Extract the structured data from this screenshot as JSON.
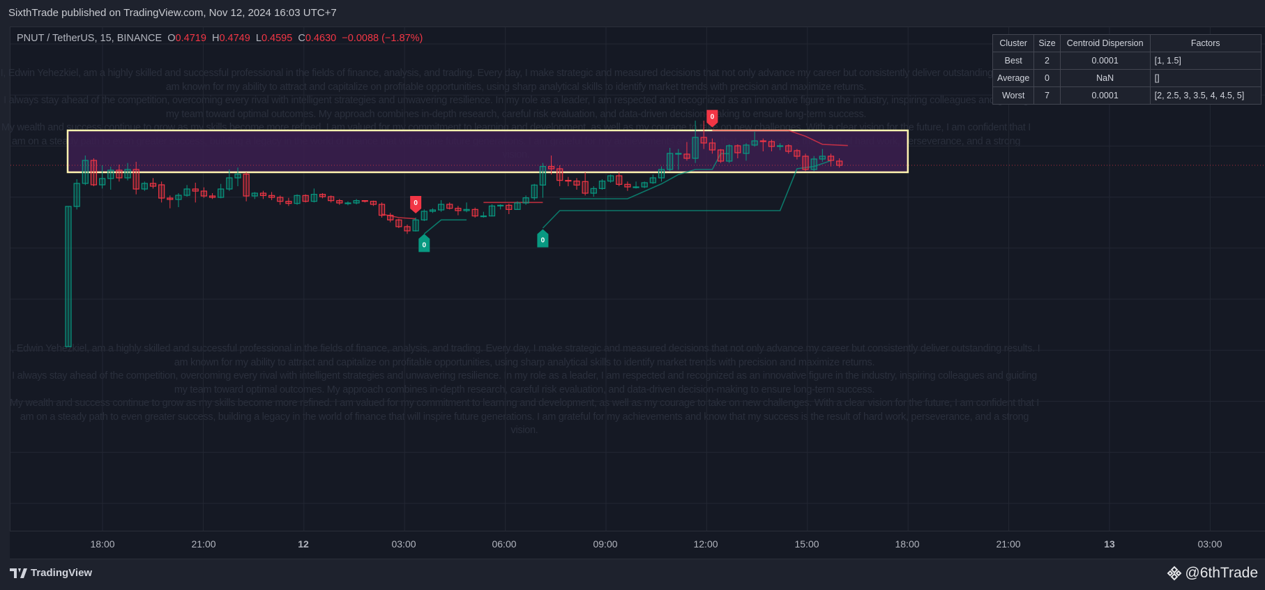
{
  "header": {
    "published": "SixthTrade published on TradingView.com, Nov 12, 2024 16:03 UTC+7"
  },
  "symbol": {
    "name": "PNUT / TetherUS, 15, BINANCE",
    "o_label": "O",
    "o": "0.4719",
    "h_label": "H",
    "h": "0.4749",
    "l_label": "L",
    "l": "0.4595",
    "c_label": "C",
    "c": "0.4630",
    "change": "−0.0088 (−1.87%)"
  },
  "table": {
    "headers": [
      "Cluster",
      "Size",
      "Centroid Dispersion",
      "Factors"
    ],
    "rows": [
      [
        "Best",
        "2",
        "0.0001",
        "[1, 1.5]"
      ],
      [
        "Average",
        "0",
        "NaN",
        "[]"
      ],
      [
        "Worst",
        "7",
        "0.0001",
        "[2, 2.5, 3, 3.5, 4, 4.5, 5]"
      ]
    ]
  },
  "watermark": [
    "I, Edwin Yehezkiel, am a highly skilled and successful professional in the fields of finance, analysis, and trading. Every day, I make strategic and measured decisions that not only advance my career but consistently deliver outstanding results. I am known for my ability to attract and capitalize on profitable opportunities, using sharp analytical skills to identify market trends with precision and maximize returns.",
    "I always stay ahead of the competition, overcoming every rival with intelligent strategies and unwavering resilience. In my role as a leader, I am respected and recognized as an innovative figure in the industry, inspiring colleagues and guiding my team toward optimal outcomes. My approach combines in-depth research, careful risk evaluation, and data-driven decision-making to ensure long-term success.",
    "My wealth and success continue to grow as my skills become more refined. I am valued for my commitment to learning and development, as well as my courage to take on new challenges. With a clear vision for the future, I am confident that I am on a steady path to even greater success, building a legacy in the world of finance that will inspire future generations. I am grateful for my achievements and know that my success is the result of hard work, perseverance, and a strong vision."
  ],
  "time_axis": [
    "18:00",
    "21:00",
    "12",
    "03:00",
    "06:00",
    "09:00",
    "12:00",
    "15:00",
    "18:00",
    "21:00",
    "13",
    "03:00"
  ],
  "footer": {
    "brand": "TradingView",
    "user": "@6thTrade"
  },
  "colors": {
    "up": "#089981",
    "down": "#f23645",
    "box_fill": "#3b1f4f",
    "box_border": "#fff3b0"
  },
  "chart_data": {
    "type": "candlestick",
    "interval": "15",
    "last_price": 0.463,
    "candles": [
      [
        0.385,
        0.4453,
        0.385,
        0.4453
      ],
      [
        0.4453,
        0.457,
        0.444,
        0.4552
      ],
      [
        0.4552,
        0.4672,
        0.4545,
        0.4651
      ],
      [
        0.4651,
        0.466,
        0.454,
        0.4546
      ],
      [
        0.4546,
        0.463,
        0.453,
        0.4573
      ],
      [
        0.4573,
        0.4624,
        0.4525,
        0.4609
      ],
      [
        0.4609,
        0.4633,
        0.456,
        0.4576
      ],
      [
        0.4576,
        0.464,
        0.4565,
        0.4612
      ],
      [
        0.4612,
        0.4645,
        0.4505,
        0.4528
      ],
      [
        0.4528,
        0.456,
        0.452,
        0.4552
      ],
      [
        0.4552,
        0.4575,
        0.453,
        0.454
      ],
      [
        0.4546,
        0.456,
        0.447,
        0.4489
      ],
      [
        0.4489,
        0.45,
        0.4445,
        0.4483
      ],
      [
        0.4483,
        0.451,
        0.445,
        0.4501
      ],
      [
        0.4501,
        0.4545,
        0.4495,
        0.4528
      ],
      [
        0.4528,
        0.4555,
        0.447,
        0.4519
      ],
      [
        0.4519,
        0.4535,
        0.449,
        0.4498
      ],
      [
        0.4498,
        0.451,
        0.4485,
        0.4492
      ],
      [
        0.4492,
        0.455,
        0.4488,
        0.4528
      ],
      [
        0.4528,
        0.4612,
        0.452,
        0.4576
      ],
      [
        0.4576,
        0.462,
        0.454,
        0.4592
      ],
      [
        0.4592,
        0.46,
        0.4475,
        0.4498
      ],
      [
        0.4498,
        0.4515,
        0.4485,
        0.451
      ],
      [
        0.451,
        0.452,
        0.4485,
        0.45
      ],
      [
        0.45,
        0.4515,
        0.448,
        0.4492
      ],
      [
        0.4492,
        0.45,
        0.446,
        0.4475
      ],
      [
        0.4475,
        0.449,
        0.4455,
        0.4466
      ],
      [
        0.4466,
        0.4505,
        0.446,
        0.45
      ],
      [
        0.45,
        0.4505,
        0.447,
        0.4475
      ],
      [
        0.4475,
        0.453,
        0.447,
        0.4505
      ],
      [
        0.4505,
        0.451,
        0.4488,
        0.4495
      ],
      [
        0.4495,
        0.45,
        0.447,
        0.4478
      ],
      [
        0.4478,
        0.4485,
        0.446,
        0.4468
      ],
      [
        0.4468,
        0.4475,
        0.4458,
        0.4468
      ],
      [
        0.4468,
        0.4485,
        0.4462,
        0.4478
      ],
      [
        0.4478,
        0.448,
        0.447,
        0.4475
      ],
      [
        0.4475,
        0.4478,
        0.4455,
        0.4462
      ],
      [
        0.4462,
        0.447,
        0.4405,
        0.4415
      ],
      [
        0.4415,
        0.4425,
        0.4385,
        0.4395
      ],
      [
        0.4395,
        0.44,
        0.436,
        0.4366
      ],
      [
        0.4366,
        0.4375,
        0.4335,
        0.4348
      ],
      [
        0.4348,
        0.4405,
        0.4345,
        0.4395
      ],
      [
        0.4395,
        0.444,
        0.439,
        0.4432
      ],
      [
        0.4432,
        0.4445,
        0.4425,
        0.4438
      ],
      [
        0.4438,
        0.448,
        0.443,
        0.4462
      ],
      [
        0.4462,
        0.447,
        0.444,
        0.4445
      ],
      [
        0.4445,
        0.4455,
        0.4415,
        0.4435
      ],
      [
        0.4435,
        0.447,
        0.4428,
        0.444
      ],
      [
        0.444,
        0.4448,
        0.4405,
        0.4412
      ],
      [
        0.4412,
        0.443,
        0.4405,
        0.4412
      ],
      [
        0.4412,
        0.4462,
        0.441,
        0.4455
      ],
      [
        0.4455,
        0.4462,
        0.444,
        0.4458
      ],
      [
        0.4458,
        0.4465,
        0.442,
        0.444
      ],
      [
        0.444,
        0.4475,
        0.4438,
        0.4468
      ],
      [
        0.4468,
        0.45,
        0.446,
        0.449
      ],
      [
        0.449,
        0.455,
        0.448,
        0.4545
      ],
      [
        0.4545,
        0.464,
        0.449,
        0.4625
      ],
      [
        0.4625,
        0.4672,
        0.459,
        0.4615
      ],
      [
        0.4615,
        0.463,
        0.454,
        0.4565
      ],
      [
        0.4565,
        0.458,
        0.454,
        0.4562
      ],
      [
        0.4562,
        0.4575,
        0.4525,
        0.4545
      ],
      [
        0.456,
        0.46,
        0.45,
        0.451
      ],
      [
        0.451,
        0.454,
        0.4495,
        0.453
      ],
      [
        0.453,
        0.457,
        0.4525,
        0.4562
      ],
      [
        0.4562,
        0.459,
        0.4555,
        0.4585
      ],
      [
        0.4585,
        0.46,
        0.454,
        0.4548
      ],
      [
        0.4548,
        0.456,
        0.452,
        0.4537
      ],
      [
        0.4537,
        0.456,
        0.453,
        0.4537
      ],
      [
        0.4537,
        0.456,
        0.4532,
        0.4555
      ],
      [
        0.4555,
        0.459,
        0.455,
        0.4576
      ],
      [
        0.4576,
        0.4625,
        0.456,
        0.4612
      ],
      [
        0.4612,
        0.4705,
        0.4605,
        0.4681
      ],
      [
        0.4681,
        0.47,
        0.461,
        0.4681
      ],
      [
        0.4678,
        0.473,
        0.465,
        0.466
      ],
      [
        0.466,
        0.4822,
        0.464,
        0.475
      ],
      [
        0.475,
        0.4822,
        0.47,
        0.4726
      ],
      [
        0.4726,
        0.4745,
        0.468,
        0.4696
      ],
      [
        0.4696,
        0.47,
        0.464,
        0.4648
      ],
      [
        0.4648,
        0.472,
        0.464,
        0.4714
      ],
      [
        0.4714,
        0.472,
        0.466,
        0.4684
      ],
      [
        0.4681,
        0.4725,
        0.465,
        0.4717
      ],
      [
        0.4717,
        0.4774,
        0.471,
        0.4735
      ],
      [
        0.4735,
        0.4745,
        0.469,
        0.4732
      ],
      [
        0.4732,
        0.474,
        0.469,
        0.4711
      ],
      [
        0.4714,
        0.4725,
        0.4695,
        0.4714
      ],
      [
        0.4714,
        0.472,
        0.468,
        0.469
      ],
      [
        0.4693,
        0.47,
        0.4655,
        0.4669
      ],
      [
        0.4669,
        0.468,
        0.4605,
        0.4612
      ],
      [
        0.4612,
        0.467,
        0.4605,
        0.4657
      ],
      [
        0.4657,
        0.47,
        0.4645,
        0.4669
      ],
      [
        0.4669,
        0.468,
        0.4625,
        0.4651
      ],
      [
        0.4648,
        0.466,
        0.462,
        0.463
      ]
    ],
    "box": {
      "from": 0,
      "to": 99,
      "top": 0.478,
      "bottom": 0.46
    },
    "lines": [
      {
        "color": "down",
        "points": [
          [
            37,
            0.442
          ],
          [
            39,
            0.4405
          ],
          [
            41,
            0.44
          ]
        ]
      },
      {
        "color": "down",
        "points": [
          [
            49,
            0.447
          ],
          [
            56,
            0.447
          ]
        ]
      },
      {
        "color": "down",
        "points": [
          [
            76,
            0.478
          ],
          [
            85,
            0.478
          ],
          [
            87,
            0.4755
          ],
          [
            89,
            0.472
          ],
          [
            92,
            0.4715
          ]
        ]
      },
      {
        "color": "up",
        "points": [
          [
            42,
            0.4335
          ],
          [
            44,
            0.4395
          ],
          [
            47,
            0.4395
          ]
        ]
      },
      {
        "color": "up",
        "points": [
          [
            56,
            0.436
          ],
          [
            58,
            0.4435
          ],
          [
            84,
            0.4435
          ],
          [
            86,
            0.4615
          ],
          [
            88,
            0.4625
          ],
          [
            90,
            0.465
          ]
        ]
      },
      {
        "color": "up",
        "points": [
          [
            58,
            0.4486
          ],
          [
            66,
            0.4486
          ],
          [
            70,
            0.455
          ],
          [
            72,
            0.459
          ],
          [
            74,
            0.4612
          ],
          [
            76,
            0.4612
          ],
          [
            77,
            0.468
          ],
          [
            78,
            0.468
          ]
        ]
      }
    ],
    "signals": [
      {
        "index": 41,
        "type": "down",
        "text": "0",
        "price": 0.442
      },
      {
        "index": 76,
        "type": "down",
        "text": "0",
        "price": 0.479
      },
      {
        "index": 42,
        "type": "up",
        "text": "0",
        "price": 0.4335
      },
      {
        "index": 56,
        "type": "up",
        "text": "0",
        "price": 0.4355
      }
    ]
  }
}
